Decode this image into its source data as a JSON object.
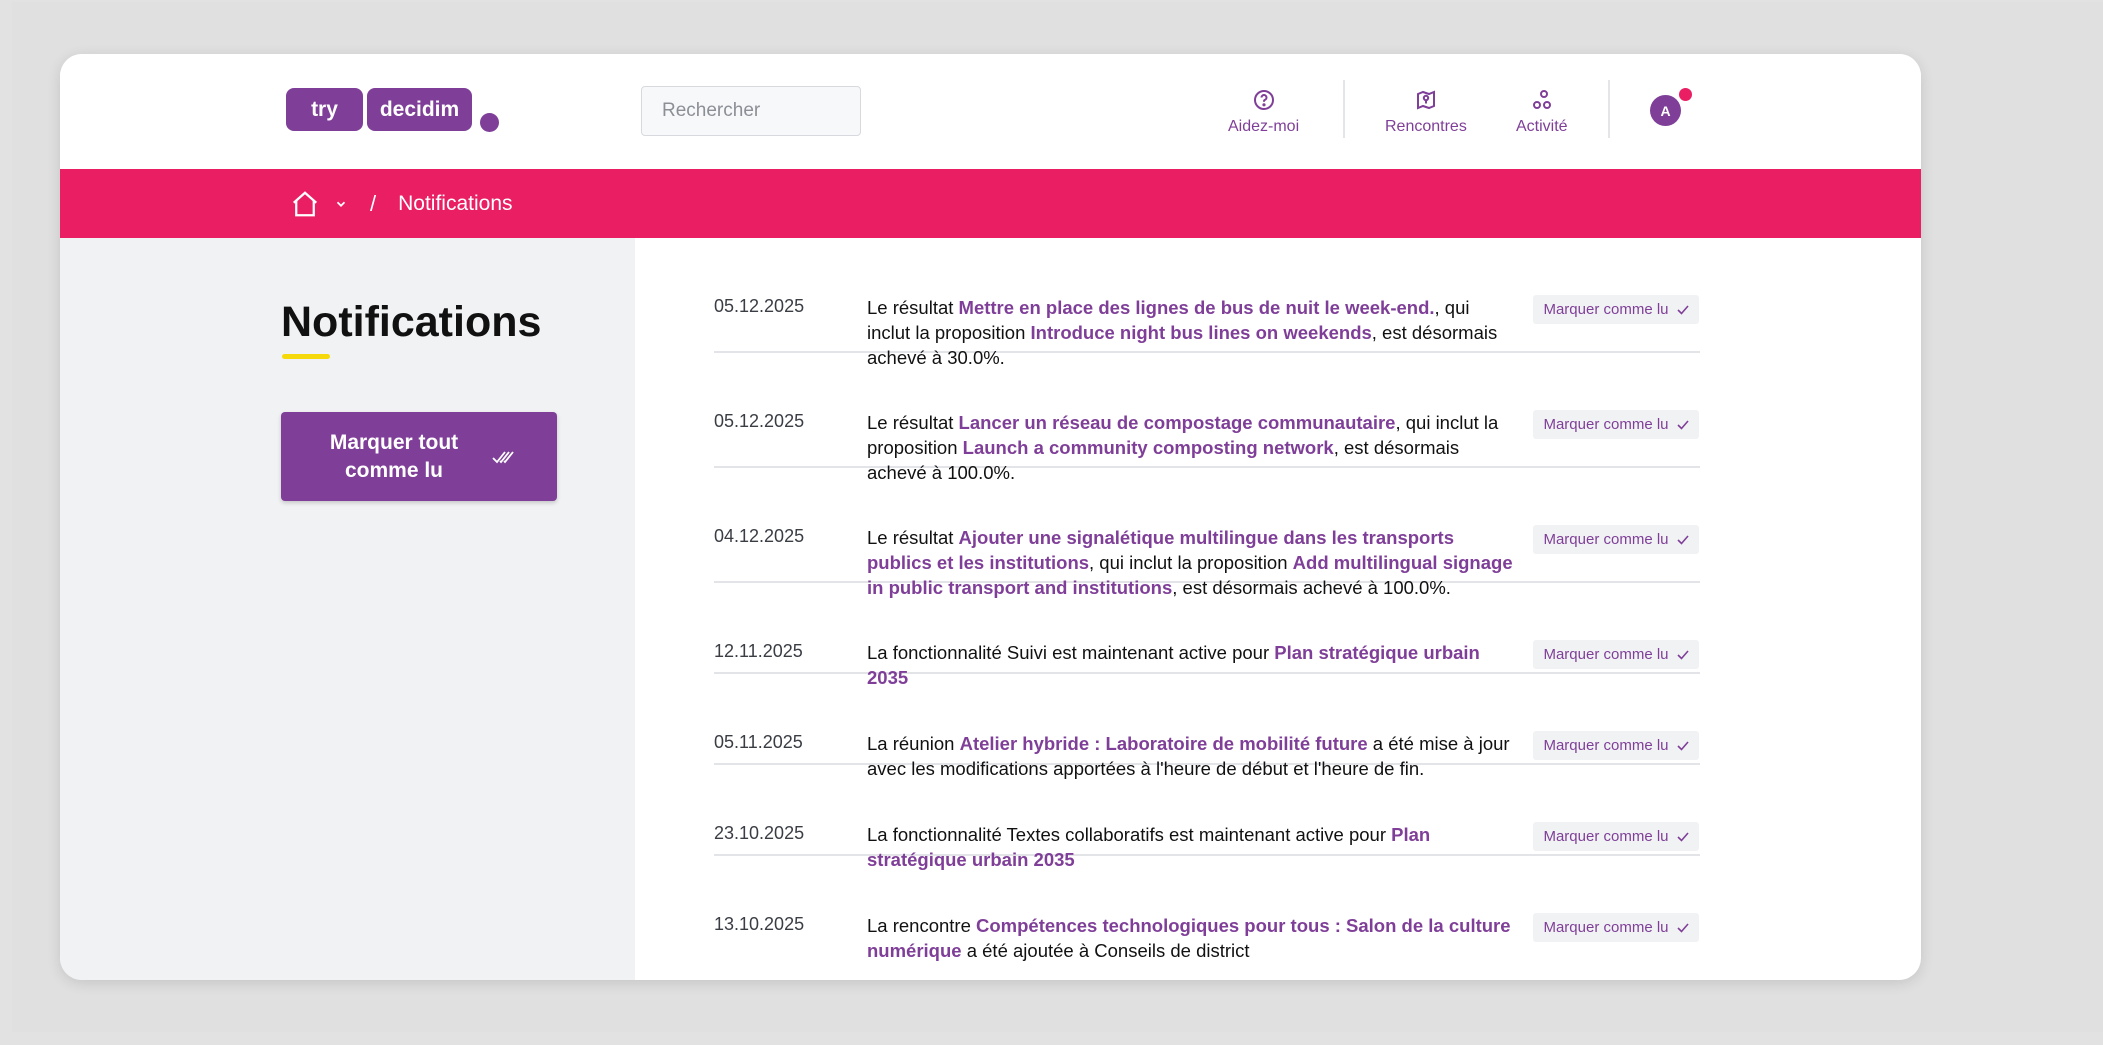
{
  "logo": {
    "part1": "try",
    "part2": "decidim"
  },
  "search": {
    "placeholder": "Rechercher"
  },
  "nav": [
    {
      "label": "Aidez-moi",
      "icon": "question-circle-icon"
    },
    {
      "label": "Rencontres",
      "icon": "map-pin-icon"
    },
    {
      "label": "Activité",
      "icon": "activity-icon"
    }
  ],
  "avatar": {
    "initial": "A"
  },
  "breadcrumb": {
    "current": "Notifications"
  },
  "sidebar": {
    "title": "Notifications",
    "mark_all_label": "Marquer tout comme lu"
  },
  "notifications": [
    {
      "date": "05.12.2025",
      "parts": [
        {
          "t": "Le résultat "
        },
        {
          "t": "Mettre en place des lignes de bus de nuit le week-end.",
          "link": true
        },
        {
          "t": ", qui inclut la proposition "
        },
        {
          "t": "Introduce night bus lines on weekends",
          "link": true
        },
        {
          "t": ", est désormais achevé à 30.0%."
        }
      ]
    },
    {
      "date": "05.12.2025",
      "parts": [
        {
          "t": "Le résultat "
        },
        {
          "t": "Lancer un réseau de compostage communautaire",
          "link": true
        },
        {
          "t": ", qui inclut la proposition "
        },
        {
          "t": "Launch a community composting network",
          "link": true
        },
        {
          "t": ", est désormais achevé à 100.0%."
        }
      ]
    },
    {
      "date": "04.12.2025",
      "parts": [
        {
          "t": "Le résultat "
        },
        {
          "t": "Ajouter une signalétique multilingue dans les transports publics et les institutions",
          "link": true
        },
        {
          "t": ", qui inclut la proposition "
        },
        {
          "t": "Add multilingual signage in public transport and institutions",
          "link": true
        },
        {
          "t": ", est désormais achevé à 100.0%."
        }
      ]
    },
    {
      "date": "12.11.2025",
      "parts": [
        {
          "t": "La fonctionnalité Suivi est maintenant active pour "
        },
        {
          "t": "Plan stratégique urbain 2035",
          "link": true
        }
      ]
    },
    {
      "date": "05.11.2025",
      "parts": [
        {
          "t": "La réunion "
        },
        {
          "t": "Atelier hybride : Laboratoire de mobilité future",
          "link": true
        },
        {
          "t": " a été mise à jour avec les modifications apportées à l'heure de début et l'heure de fin."
        }
      ]
    },
    {
      "date": "23.10.2025",
      "parts": [
        {
          "t": "La fonctionnalité Textes collaboratifs est maintenant active pour "
        },
        {
          "t": "Plan stratégique urbain 2035",
          "link": true
        }
      ]
    },
    {
      "date": "13.10.2025",
      "parts": [
        {
          "t": "La rencontre "
        },
        {
          "t": "Compétences technologiques pour tous : Salon de la culture numérique",
          "link": true
        },
        {
          "t": " a été ajoutée à Conseils de district"
        }
      ]
    }
  ],
  "mark_read_label": "Marquer comme lu",
  "colors": {
    "primary": "#7f3f98",
    "secondary": "#e91e63",
    "tertiary": "#f5d90a"
  }
}
